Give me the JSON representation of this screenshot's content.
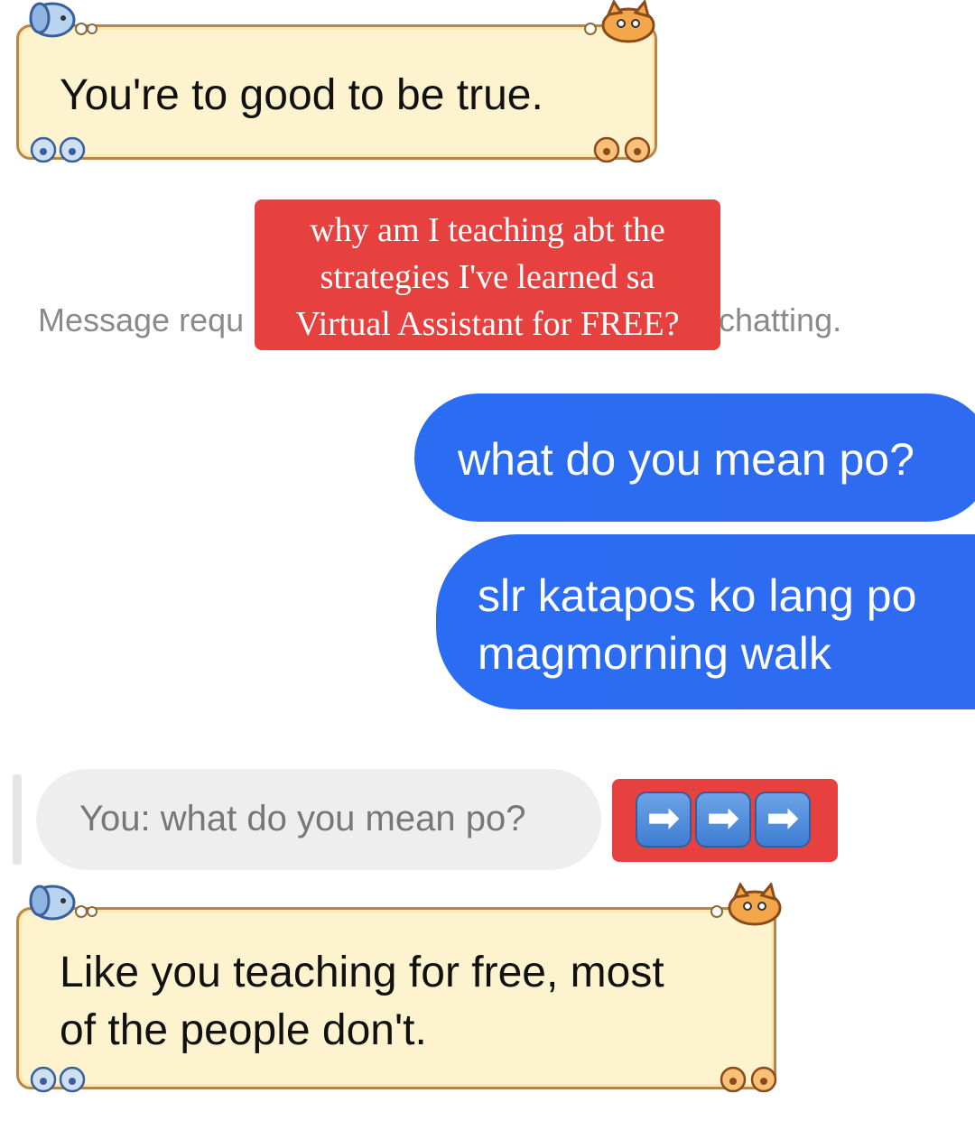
{
  "cards": {
    "top_text": "You're to good to be true.",
    "bottom_line1": "Like you teaching for free, most",
    "bottom_line2": "of the people don't."
  },
  "red_note": {
    "line1": "why am I teaching abt the",
    "line2": "strategies I've learned sa",
    "line3": "Virtual Assistant for FREE?"
  },
  "system_message": {
    "left": "Message requ",
    "right": "chatting."
  },
  "messages": [
    {
      "text": "what do you mean po?"
    },
    {
      "line1": "slr katapos ko lang po",
      "line2": "magmorning walk"
    }
  ],
  "preview": {
    "text": "You: what do you mean po?"
  },
  "arrows": {
    "glyph": "➡"
  },
  "colors": {
    "card_fill": "#fdf4cf",
    "card_border": "#b8854a",
    "bubble_blue": "#2f6bf0",
    "note_red": "#e6413f",
    "system_gray": "#8a8a8e"
  },
  "icons": [
    "dog-icon",
    "cat-icon",
    "paw-icon"
  ]
}
